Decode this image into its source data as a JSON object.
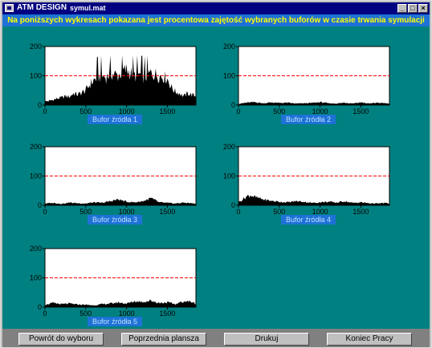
{
  "window": {
    "app_title": "ATM DESIGN",
    "file_name": "symul.mat",
    "minimize": "_",
    "maximize": "□",
    "close": "×"
  },
  "banner": "Na poniższych wykresach pokazana jest procentowa zajętość wybranych buforów w czasie trwania symulacji",
  "colors": {
    "background": "#008080",
    "banner": "#1e72d6",
    "banner_text": "#ffff00",
    "threshold": "#ff0000",
    "fill": "#000000"
  },
  "chart_data": [
    {
      "type": "area",
      "label": "Bufor źródła  1",
      "ylim": [
        0,
        200
      ],
      "xlim": [
        0,
        1850
      ],
      "yticks": [
        "0",
        "100",
        "200"
      ],
      "xticks": [
        "0",
        "500",
        "1000",
        "1500"
      ],
      "threshold": 100,
      "series": [
        {
          "x": [
            0,
            50,
            100,
            150,
            200,
            250,
            300,
            350,
            400,
            450,
            500,
            550,
            600,
            650,
            700,
            750,
            800,
            850,
            900,
            950,
            1000,
            1050,
            1100,
            1150,
            1200,
            1250,
            1300,
            1350,
            1400,
            1450,
            1500,
            1550,
            1600,
            1650,
            1700,
            1750,
            1800,
            1850
          ],
          "y": [
            12,
            14,
            18,
            22,
            25,
            30,
            28,
            40,
            35,
            42,
            50,
            70,
            85,
            95,
            100,
            95,
            110,
            105,
            100,
            115,
            120,
            110,
            100,
            105,
            95,
            100,
            110,
            105,
            100,
            98,
            90,
            60,
            45,
            40,
            30,
            40,
            35,
            30
          ]
        }
      ]
    },
    {
      "type": "area",
      "label": "Bufor źródła  2",
      "ylim": [
        0,
        200
      ],
      "xlim": [
        0,
        1850
      ],
      "yticks": [
        "0",
        "100",
        "200"
      ],
      "xticks": [
        "0",
        "500",
        "1000",
        "1500"
      ],
      "threshold": 100,
      "series": [
        {
          "x": [
            0,
            100,
            200,
            300,
            400,
            500,
            600,
            700,
            800,
            900,
            1000,
            1100,
            1200,
            1300,
            1400,
            1500,
            1600,
            1700,
            1800,
            1850
          ],
          "y": [
            4,
            8,
            10,
            6,
            9,
            7,
            8,
            5,
            6,
            7,
            10,
            6,
            5,
            8,
            6,
            9,
            5,
            8,
            6,
            5
          ]
        }
      ]
    },
    {
      "type": "area",
      "label": "Bufor źródła  3",
      "ylim": [
        0,
        200
      ],
      "xlim": [
        0,
        1850
      ],
      "yticks": [
        "0",
        "100",
        "200"
      ],
      "xticks": [
        "0",
        "500",
        "1000",
        "1500"
      ],
      "threshold": 100,
      "series": [
        {
          "x": [
            0,
            100,
            200,
            300,
            400,
            500,
            600,
            700,
            800,
            900,
            1000,
            1100,
            1200,
            1300,
            1400,
            1500,
            1600,
            1700,
            1800,
            1850
          ],
          "y": [
            6,
            8,
            5,
            9,
            7,
            6,
            10,
            8,
            14,
            20,
            12,
            10,
            14,
            24,
            10,
            8,
            6,
            9,
            7,
            5
          ]
        }
      ]
    },
    {
      "type": "area",
      "label": "Bufor źródła  4",
      "ylim": [
        0,
        200
      ],
      "xlim": [
        0,
        1850
      ],
      "yticks": [
        "0",
        "100",
        "200"
      ],
      "xticks": [
        "0",
        "500",
        "1000",
        "1500"
      ],
      "threshold": 100,
      "series": [
        {
          "x": [
            0,
            100,
            150,
            200,
            300,
            400,
            500,
            600,
            700,
            800,
            900,
            1000,
            1100,
            1200,
            1300,
            1400,
            1500,
            1600,
            1700,
            1800,
            1850
          ],
          "y": [
            10,
            30,
            35,
            28,
            20,
            15,
            12,
            10,
            14,
            12,
            8,
            10,
            12,
            9,
            14,
            8,
            10,
            7,
            6,
            8,
            5
          ]
        }
      ]
    },
    {
      "type": "area",
      "label": "Bufor źródła  5",
      "ylim": [
        0,
        200
      ],
      "xlim": [
        0,
        1850
      ],
      "yticks": [
        "0",
        "100",
        "200"
      ],
      "xticks": [
        "0",
        "500",
        "1000",
        "1500"
      ],
      "threshold": 100,
      "series": [
        {
          "x": [
            0,
            100,
            200,
            300,
            400,
            500,
            600,
            700,
            800,
            900,
            1000,
            1100,
            1200,
            1300,
            1400,
            1500,
            1600,
            1700,
            1800,
            1850
          ],
          "y": [
            8,
            14,
            10,
            12,
            9,
            8,
            6,
            10,
            12,
            16,
            12,
            20,
            18,
            22,
            14,
            16,
            10,
            20,
            18,
            10
          ]
        }
      ]
    }
  ],
  "buttons": {
    "back": "Powrót do wyboru",
    "previous": "Poprzednia plansza",
    "print": "Drukuj",
    "end": "Koniec Pracy"
  }
}
